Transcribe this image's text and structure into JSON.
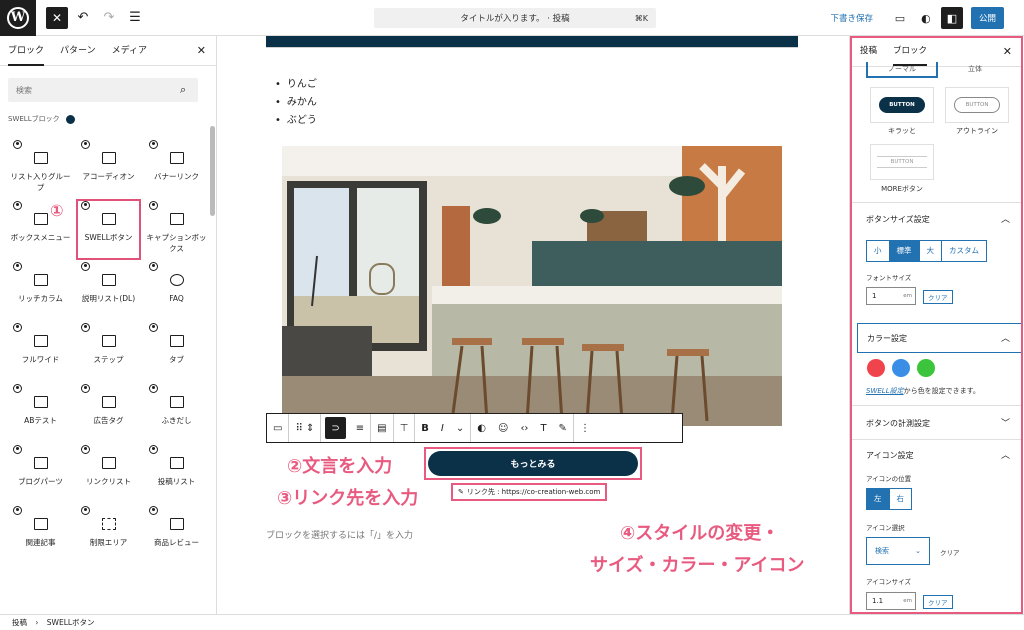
{
  "topbar": {
    "close_label": "✕",
    "doc_title": "タイトルが入ります。 · 投稿",
    "shortcut": "⌘K",
    "draft_label": "下書き保存",
    "publish_label": "公開"
  },
  "left_panel": {
    "tabs": [
      "ブロック",
      "パターン",
      "メディア"
    ],
    "search_placeholder": "検索",
    "section_label": "SWELLブロック",
    "blocks": [
      {
        "label": "リスト入りグループ",
        "icon": "list-group-icon"
      },
      {
        "label": "アコーディオン",
        "icon": "accordion-icon"
      },
      {
        "label": "バナーリンク",
        "icon": "banner-link-icon"
      },
      {
        "label": "ボックスメニュー",
        "icon": "box-menu-icon"
      },
      {
        "label": "SWELLボタン",
        "icon": "swell-button-icon"
      },
      {
        "label": "キャプションボックス",
        "icon": "caption-box-icon"
      },
      {
        "label": "リッチカラム",
        "icon": "rich-column-icon"
      },
      {
        "label": "説明リスト(DL)",
        "icon": "description-list-icon"
      },
      {
        "label": "FAQ",
        "icon": "faq-icon"
      },
      {
        "label": "フルワイド",
        "icon": "full-wide-icon"
      },
      {
        "label": "ステップ",
        "icon": "step-icon"
      },
      {
        "label": "タブ",
        "icon": "tab-icon"
      },
      {
        "label": "ABテスト",
        "icon": "ab-test-icon"
      },
      {
        "label": "広告タグ",
        "icon": "ad-tag-icon"
      },
      {
        "label": "ふきだし",
        "icon": "speech-bubble-icon"
      },
      {
        "label": "ブログパーツ",
        "icon": "blog-parts-icon"
      },
      {
        "label": "リンクリスト",
        "icon": "link-list-icon"
      },
      {
        "label": "投稿リスト",
        "icon": "post-list-icon"
      },
      {
        "label": "関連記事",
        "icon": "related-posts-icon"
      },
      {
        "label": "制限エリア",
        "icon": "restricted-area-icon"
      },
      {
        "label": "商品レビュー",
        "icon": "product-review-icon"
      }
    ]
  },
  "annotations": {
    "step1": "①",
    "step2": "②文言を入力",
    "step3": "③リンク先を入力",
    "step4_line1": "④スタイルの変更・",
    "step4_line2": "サイズ・カラー・アイコン"
  },
  "editor": {
    "list_items": [
      "りんご",
      "みかん",
      "ぶどう"
    ],
    "button_text": "もっとみる",
    "link_label": "リンク先 : https://co-creation-web.com",
    "placeholder": "ブロックを選択するには「/」を入力"
  },
  "right_panel": {
    "tabs": [
      "投稿",
      "ブロック"
    ],
    "style_normal": "ノーマル",
    "style_3d": "立体",
    "styles": [
      {
        "preview": "BUTTON",
        "label": "キラッと"
      },
      {
        "preview": "BUTTON",
        "label": "アウトライン"
      },
      {
        "preview": "BUTTON",
        "label": "MOREボタン"
      }
    ],
    "size_section": "ボタンサイズ設定",
    "size_options": [
      "小",
      "標準",
      "大",
      "カスタム"
    ],
    "font_size_label": "フォントサイズ",
    "font_size_value": "1",
    "unit_em": "em",
    "clear_label": "クリア",
    "color_section": "カラー設定",
    "colors": [
      "#f0444d",
      "#3a8ee6",
      "#3cc43c"
    ],
    "swell_note_link": "SWELL設定",
    "swell_note_text": "から色を設定できます。",
    "measure_section": "ボタンの計測設定",
    "icon_section": "アイコン設定",
    "icon_position_label": "アイコンの位置",
    "icon_positions": [
      "左",
      "右"
    ],
    "icon_select_label": "アイコン選択",
    "icon_select_value": "検索",
    "icon_size_label": "アイコンサイズ",
    "icon_size_value": "1.1"
  },
  "footer": {
    "crumb1": "投稿",
    "crumb_sep": "›",
    "crumb2": "SWELLボタン"
  },
  "colors": {
    "accent": "#2271b1",
    "navy": "#0b3149",
    "annotation": "#e85a7f"
  }
}
